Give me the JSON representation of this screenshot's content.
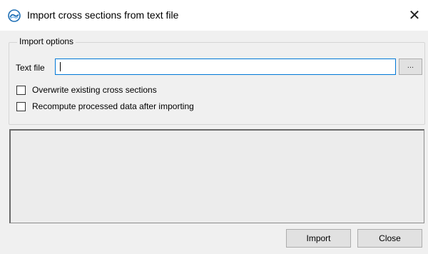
{
  "window": {
    "title": "Import cross sections from text file",
    "icon": "app-wave-icon",
    "close_glyph": "✕"
  },
  "import_options": {
    "legend": "Import options",
    "text_file_label": "Text file",
    "text_file_value": "",
    "browse_label": "..."
  },
  "checkboxes": [
    {
      "label": "Overwrite existing cross sections",
      "checked": false
    },
    {
      "label": "Recompute processed data after importing",
      "checked": false
    }
  ],
  "output": {
    "text": ""
  },
  "buttons": {
    "import_label": "Import",
    "close_label": "Close"
  },
  "colors": {
    "focus_border": "#0078d7",
    "dialog_bg": "#f0f0f0",
    "button_bg": "#e1e1e1",
    "icon_blue": "#1f6fb5"
  }
}
